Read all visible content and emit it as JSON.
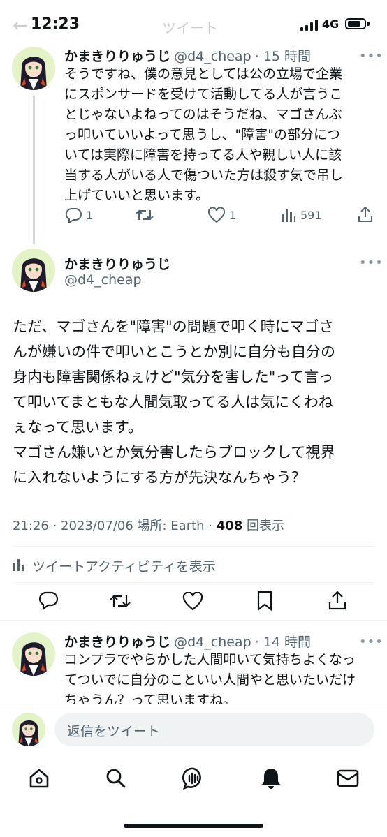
{
  "status_bar": {
    "time": "12:23",
    "network": "4G"
  },
  "header": {
    "title": "ツイート"
  },
  "parent_tweet": {
    "name": "かまきりりゅうじ",
    "handle": "@d4_cheap",
    "time": "· 15 時間",
    "text": "そうですね、僕の意見としては公の立場で企業\nにスポンサードを受けて活動してる人が言うこ\nとじゃないよねってのはそうだね、マゴさんぶ\nっ叩いていいよって思うし、\"障害\"の部分につ\nいては実際に障害を持ってる人や親しい人に該\n当する人がいる人で傷ついた方は殺す気で吊し\n上げていいと思います。",
    "replies": "1",
    "likes": "1",
    "views": "591"
  },
  "main_tweet": {
    "name": "かまきりりゅうじ",
    "handle": "@d4_cheap",
    "text": "ただ、マゴさんを\"障害\"の問題で叩く時にマゴさ\nんが嫌いの件で叩いとこうとか別に自分も自分の\n身内も障害関係ねぇけど\"気分を害した\"って言っ\nて叩いてまともな人間気取ってる人は気にくわね\nぇなって思います。\nマゴさん嫌いとか気分害したらブロックして視界\nに入れないようにする方が先決なんちゃう？",
    "timestamp": "21:26 · 2023/07/06 場所: Earth · ",
    "views_count": "408",
    "views_label": " 回表示",
    "activity_label": "ツイートアクティビティを表示"
  },
  "reply_tweet": {
    "name": "かまきりりゅうじ",
    "handle": "@d4_cheap",
    "time": "· 14 時間",
    "text": "コンプラでやらかした人間叩いて気持ちよくなっ\nてついでに自分のこといい人間やと思いたいだけ\nちゃうん？って思いますね。"
  },
  "reply_box": {
    "placeholder": "返信をツイート"
  },
  "colors": {
    "text": "#0f1419",
    "secondary": "#536471",
    "avatar_bg": "#e3f2c7"
  },
  "nav": [
    "home-icon",
    "search-icon",
    "spaces-icon",
    "notifications-icon",
    "messages-icon"
  ]
}
